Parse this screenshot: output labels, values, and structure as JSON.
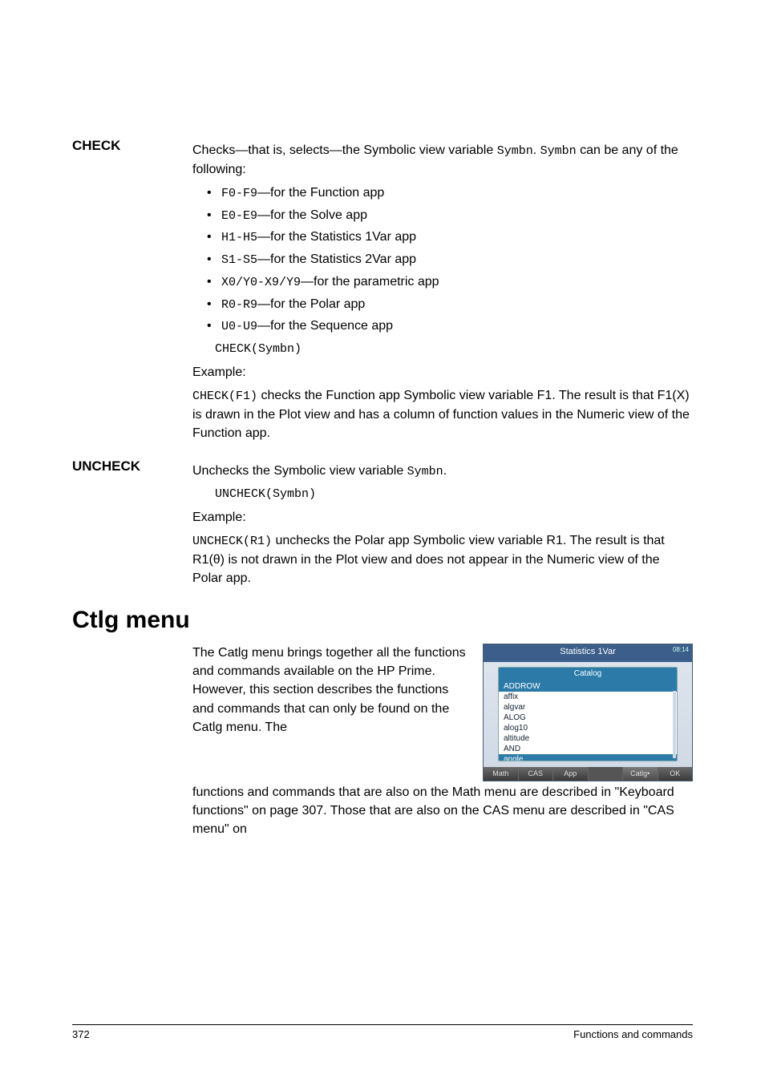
{
  "check": {
    "label": "CHECK",
    "intro_a": "Checks—that is, selects—the Symbolic view variable ",
    "intro_code1": "Symbn",
    "intro_b": ". ",
    "intro_code2": "Symbn",
    "intro_c": " can be any of the following:",
    "bullets": [
      {
        "code": "F0-F9",
        "text": "—for the Function app"
      },
      {
        "code": "E0-E9",
        "text": "—for the Solve app"
      },
      {
        "code": "H1-H5",
        "text": "—for the Statistics 1Var app"
      },
      {
        "code": "S1-S5",
        "text": "—for the Statistics 2Var app"
      },
      {
        "code": "X0/Y0-X9/Y9",
        "text": "—for the parametric app"
      },
      {
        "code": "R0-R9",
        "text": "—for the Polar app"
      },
      {
        "code": "U0-U9",
        "text": "—for the Sequence app"
      }
    ],
    "syntax": "CHECK(Symbn)",
    "example_label": "Example:",
    "example_code": "CHECK(F1)",
    "example_text": " checks the Function app Symbolic view variable F1. The result is that F1(X) is drawn in the Plot view and has a column of function values in the Numeric view of the Function app."
  },
  "uncheck": {
    "label": "UNCHECK",
    "intro_a": "Unchecks the Symbolic view variable ",
    "intro_code": "Symbn",
    "intro_b": ".",
    "syntax": "UNCHECK(Symbn)",
    "example_label": "Example:",
    "example_code": "UNCHECK(R1)",
    "example_text": " unchecks the Polar app Symbolic view variable R1. The result is that R1(θ) is not drawn in the Plot view and does not appear in the Numeric view of the Polar app."
  },
  "ctlg": {
    "heading": "Ctlg menu",
    "para1": "The Catlg menu brings together all the functions and commands available on the HP Prime. However, this section describes the functions and commands that can only be found on the Catlg menu. The",
    "para2": "functions and commands that are also on the Math menu are described in \"Keyboard functions\" on page 307. Those that are also on the CAS menu are described in \"CAS menu\" on"
  },
  "screenshot": {
    "title": "Statistics 1Var",
    "time": "08:14",
    "catalog_label": "Catalog",
    "items": [
      "ADDROW",
      "affix",
      "algvar",
      "ALOG",
      "alog10",
      "altitude",
      "AND",
      "angle"
    ],
    "softkeys": [
      "Math",
      "CAS",
      "App",
      "",
      "Catlg•",
      "OK"
    ]
  },
  "footer": {
    "page": "372",
    "title": "Functions and commands"
  }
}
